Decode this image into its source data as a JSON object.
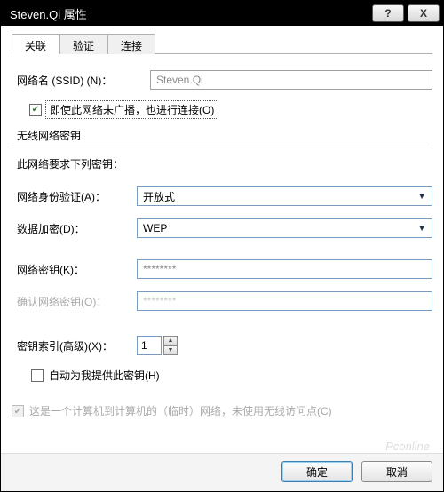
{
  "title": "Steven.Qi 属性",
  "title_buttons": {
    "help": "?",
    "close": "X"
  },
  "tabs": [
    "关联",
    "验证",
    "连接"
  ],
  "active_tab": 0,
  "ssid_group": {
    "label": "网络名 (SSID) (N)：",
    "value": "Steven.Qi"
  },
  "broadcast_checkbox": {
    "checked": true,
    "label": "即使此网络未广播，也进行连接(O)"
  },
  "key_group_title": "无线网络密钥",
  "key_group_desc": "此网络要求下列密钥：",
  "auth": {
    "label": "网络身份验证(A)：",
    "value": "开放式"
  },
  "encrypt": {
    "label": "数据加密(D)：",
    "value": "WEP"
  },
  "key": {
    "label": "网络密钥(K)：",
    "value": "********"
  },
  "key_confirm": {
    "label": "确认网络密钥(O)：",
    "value": "********",
    "disabled": true
  },
  "key_index": {
    "label": "密钥索引(高级)(X)：",
    "value": "1"
  },
  "auto_key": {
    "checked": false,
    "label": "自动为我提供此密钥(H)"
  },
  "adhoc": {
    "checked": true,
    "disabled": true,
    "label": "这是一个计算机到计算机的（临时）网络，未使用无线访问点(C)"
  },
  "buttons": {
    "ok": "确定",
    "cancel": "取消"
  },
  "watermark": "Pconline"
}
